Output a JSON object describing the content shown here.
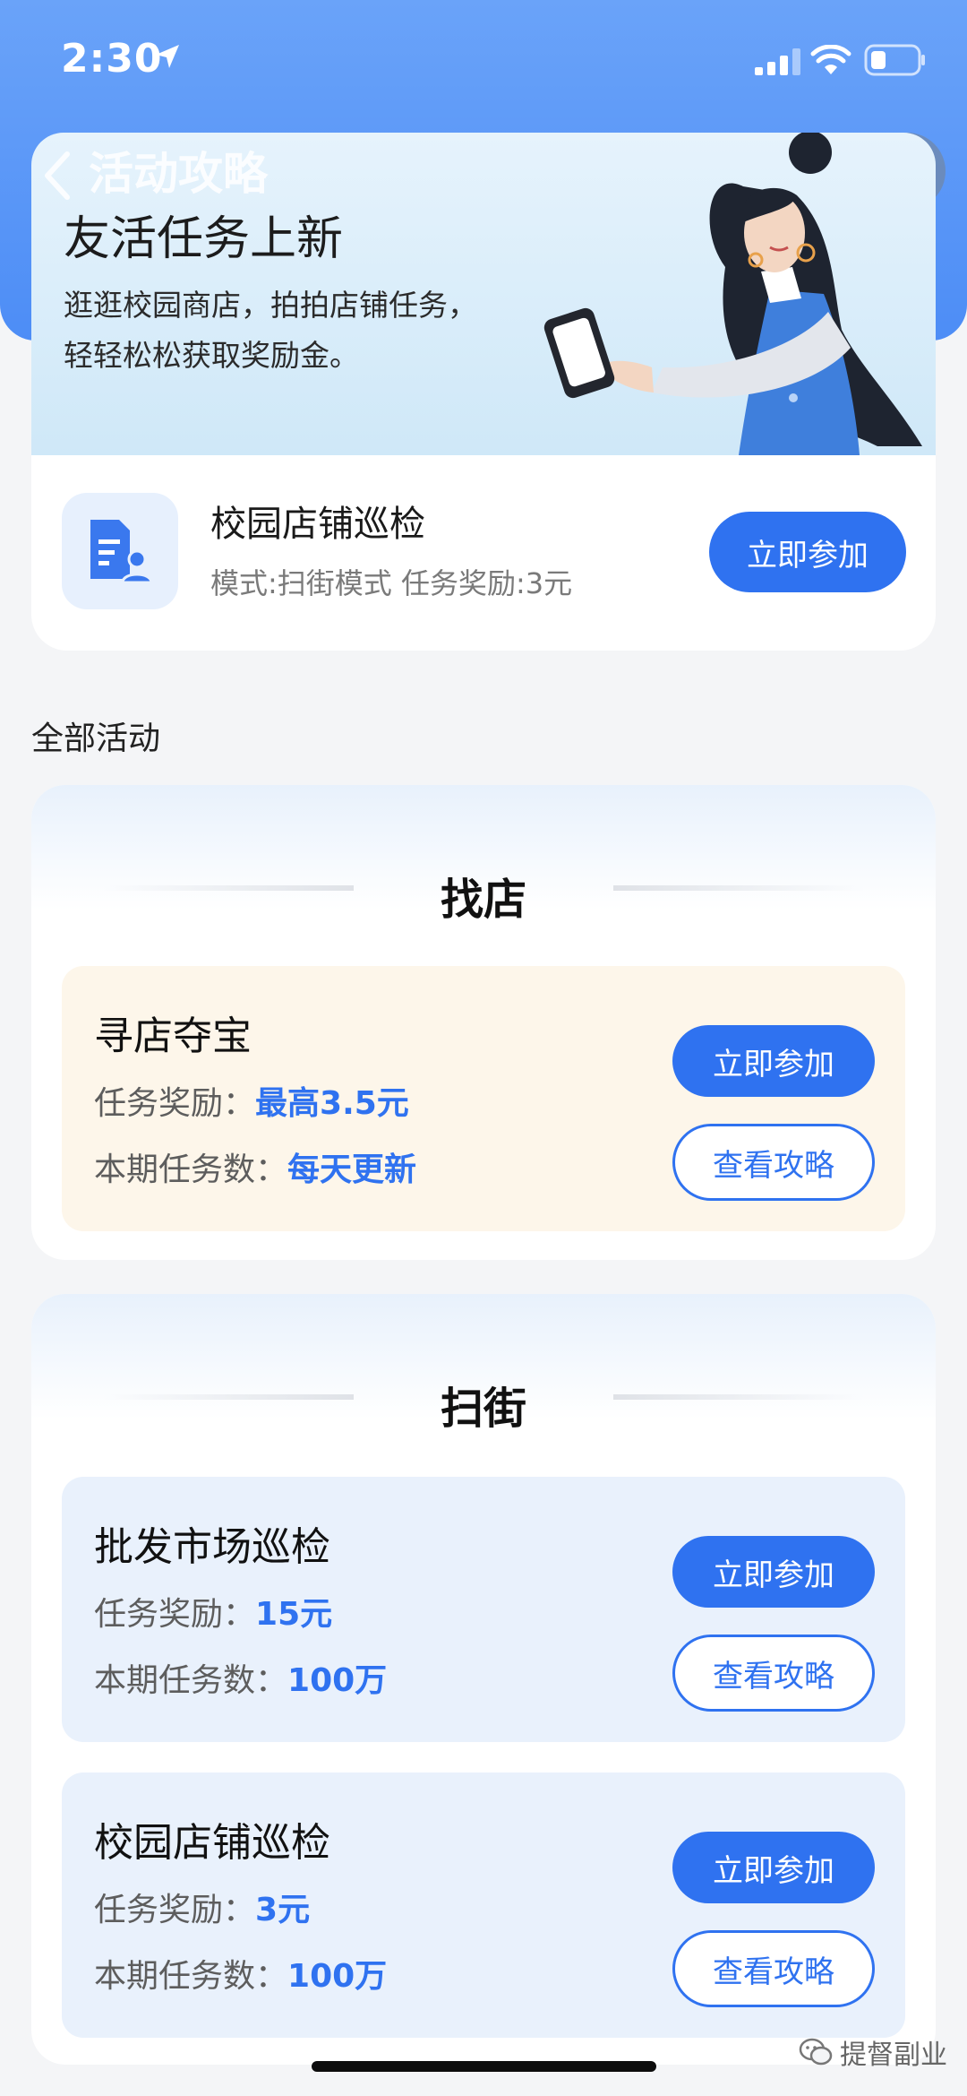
{
  "status": {
    "time": "2:30"
  },
  "nav": {
    "title": "活动攻略"
  },
  "banner": {
    "title": "友活任务上新",
    "description": "逛逛校园商店，拍拍店铺任务，轻轻松松获取奖励金。"
  },
  "featured": {
    "title": "校园店铺巡检",
    "meta": "模式:扫街模式 任务奖励:3元",
    "join_label": "立即参加"
  },
  "section_label": "全部活动",
  "categories": [
    {
      "title": "找店",
      "tasks": [
        {
          "name": "寻店夺宝",
          "reward_label": "任务奖励：",
          "reward_value": "最高3.5元",
          "count_label": "本期任务数：",
          "count_value": "每天更新",
          "join_label": "立即参加",
          "guide_label": "查看攻略"
        }
      ]
    },
    {
      "title": "扫街",
      "tasks": [
        {
          "name": "批发市场巡检",
          "reward_label": "任务奖励：",
          "reward_value": "15元",
          "count_label": "本期任务数：",
          "count_value": "100万",
          "join_label": "立即参加",
          "guide_label": "查看攻略"
        },
        {
          "name": "校园店铺巡检",
          "reward_label": "任务奖励：",
          "reward_value": "3元",
          "count_label": "本期任务数：",
          "count_value": "100万",
          "join_label": "立即参加",
          "guide_label": "查看攻略"
        }
      ]
    }
  ],
  "watermark": "提督副业",
  "icons": [
    "location-arrow-icon",
    "signal-icon",
    "wifi-icon",
    "battery-icon",
    "back-chevron-icon",
    "star-icon",
    "more-dots-icon",
    "target-icon",
    "document-user-icon",
    "wechat-icon"
  ],
  "colors": {
    "primary": "#2f72f0",
    "header": "#5a96f7",
    "orange_card": "#fdf6ea",
    "blue_card": "#e9f1fc"
  }
}
